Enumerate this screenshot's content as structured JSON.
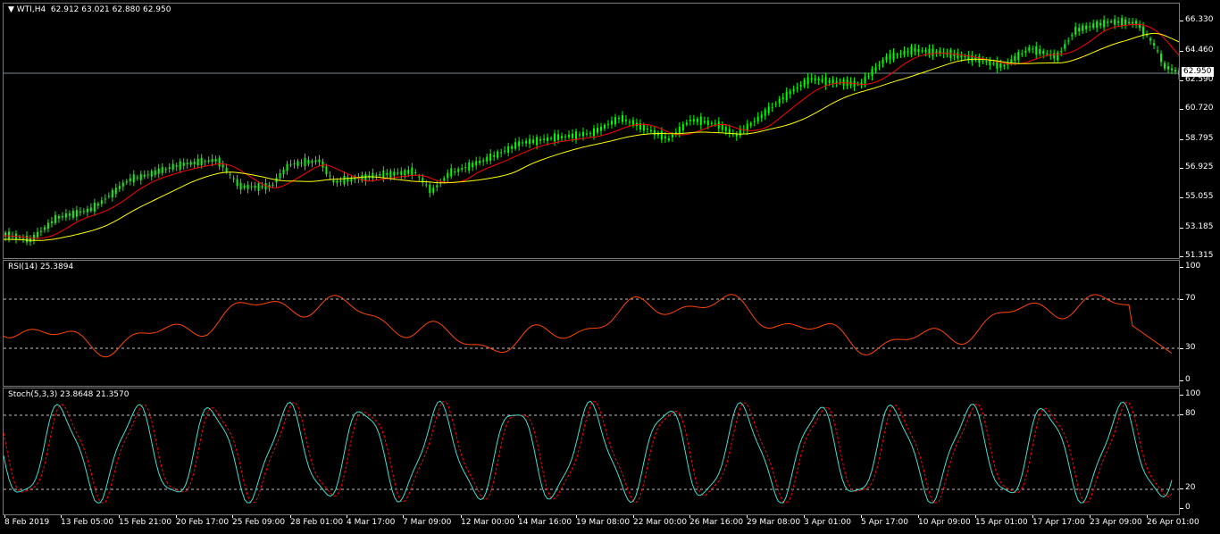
{
  "main_pane": {
    "title_prefix": "▼ WTI,H4",
    "ohlc": "62.912 63.021 62.880 62.950",
    "current_price": "62.950",
    "price_ticks": [
      "66.330",
      "64.460",
      "62.590",
      "60.720",
      "58.795",
      "56.925",
      "55.055",
      "53.185",
      "51.315"
    ],
    "colors": {
      "candle": "#00ff00",
      "ma_fast": "#ff0000",
      "ma_slow": "#ffff00",
      "price_line": "#778899"
    }
  },
  "rsi_pane": {
    "title": "RSI(14) 25.3894",
    "ticks": [
      "100",
      "70",
      "30",
      "0"
    ],
    "color": "#ff4500"
  },
  "stoch_pane": {
    "title": "Stoch(5,3,3) 23.8648 21.3570",
    "ticks": [
      "100",
      "80",
      "20",
      "0"
    ],
    "colors": {
      "main": "#40e0d0",
      "signal": "#ff0000"
    }
  },
  "time_axis": [
    "8 Feb 2019",
    "13 Feb 05:00",
    "15 Feb 21:00",
    "20 Feb 17:00",
    "25 Feb 09:00",
    "28 Feb 01:00",
    "4 Mar 17:00",
    "7 Mar 09:00",
    "12 Mar 00:00",
    "14 Mar 16:00",
    "19 Mar 08:00",
    "22 Mar 00:00",
    "26 Mar 16:00",
    "29 Mar 08:00",
    "3 Apr 01:00",
    "5 Apr 17:00",
    "10 Apr 09:00",
    "15 Apr 01:00",
    "17 Apr 17:00",
    "23 Apr 09:00",
    "26 Apr 01:00"
  ]
}
